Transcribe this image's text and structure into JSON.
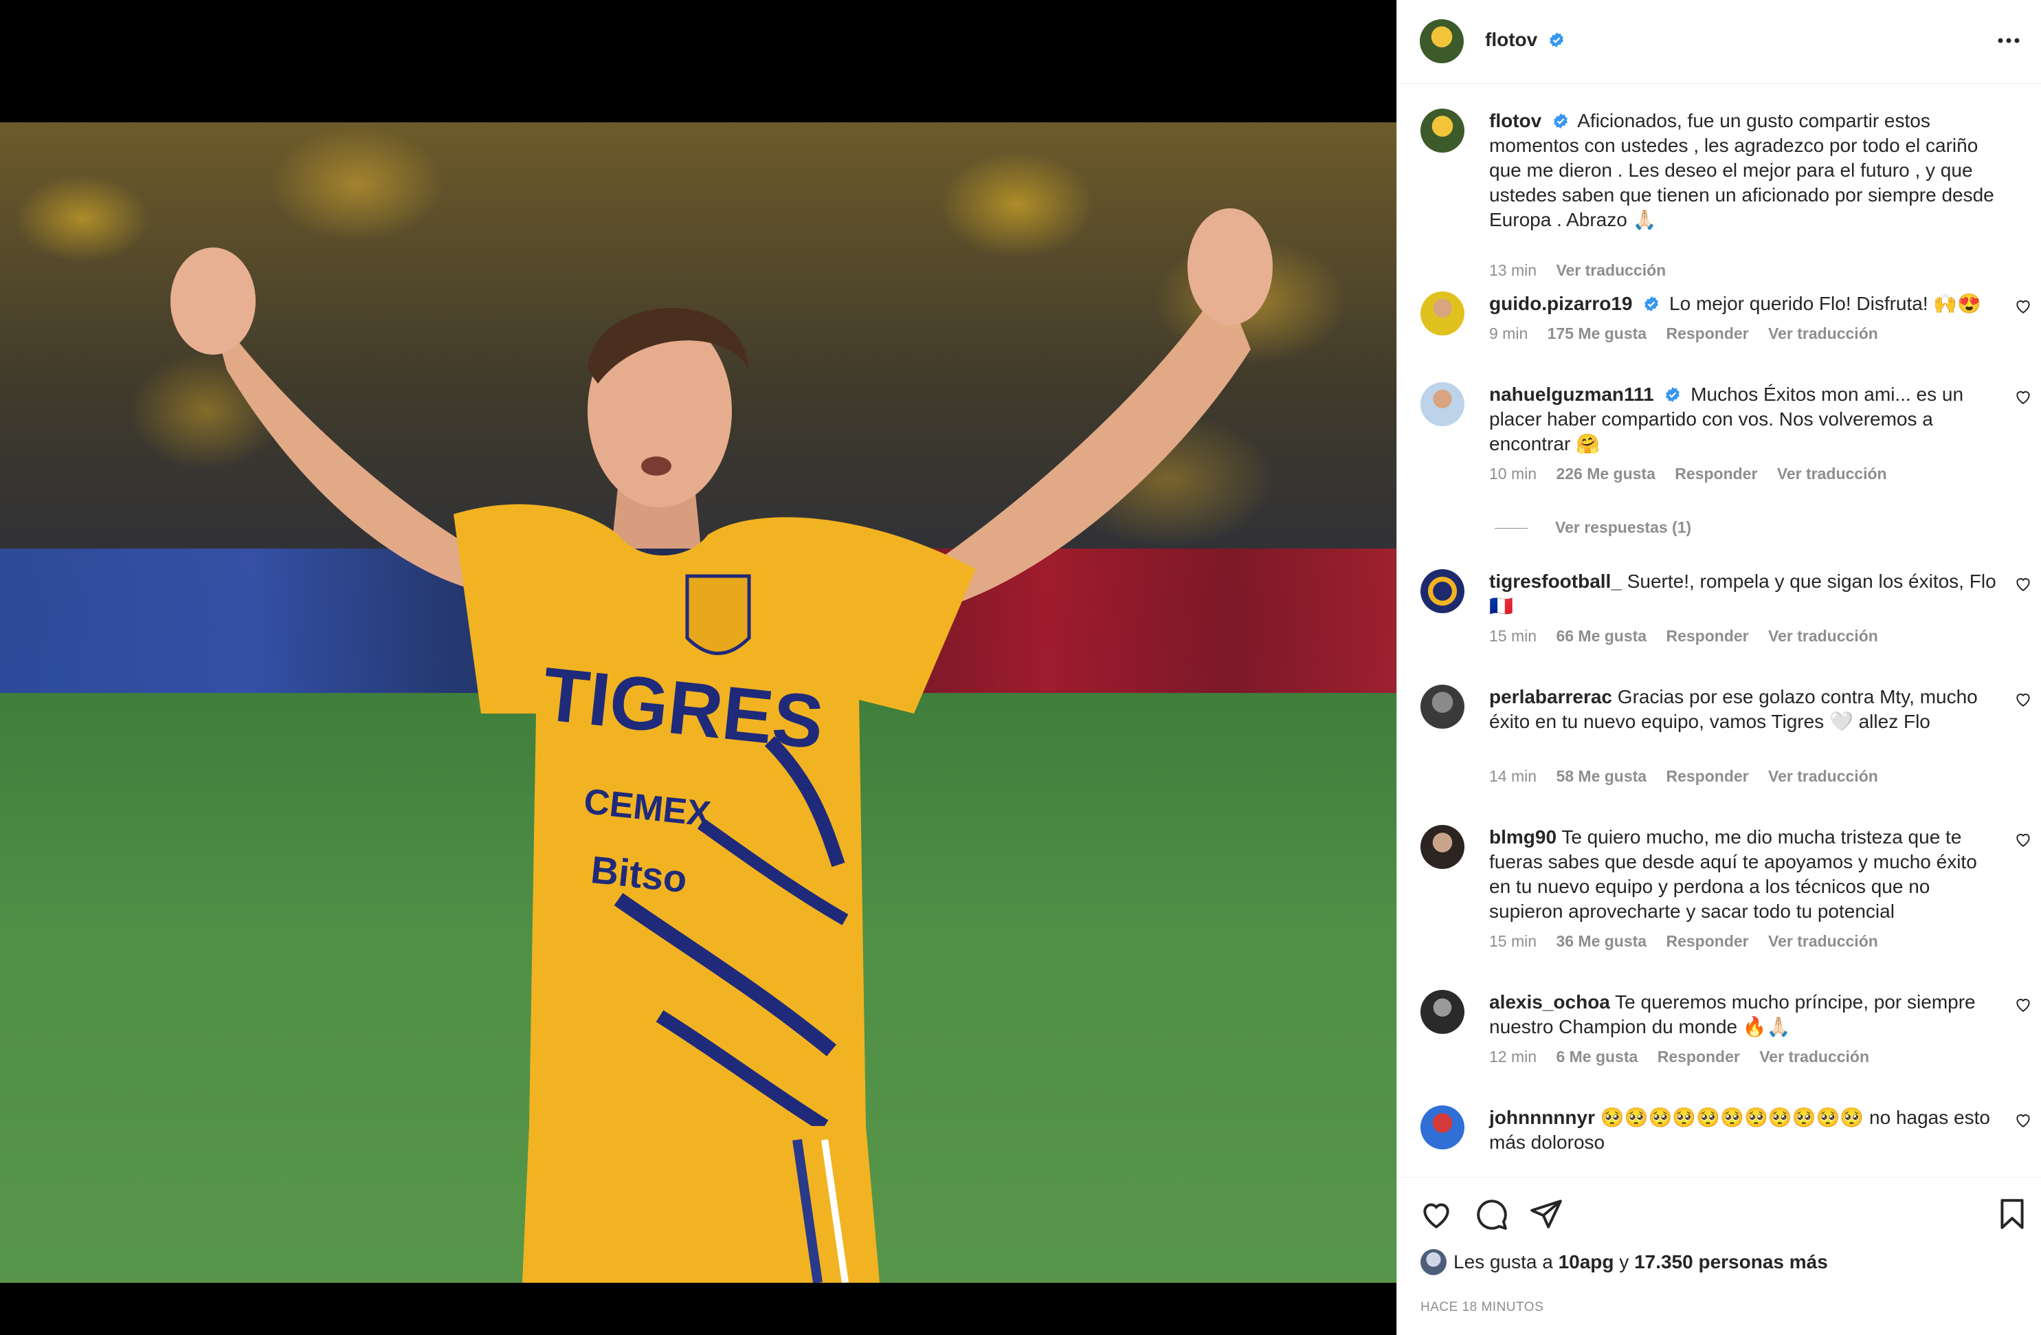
{
  "post": {
    "username": "flotov",
    "verified": true,
    "caption": "Aficionados, fue un gusto compartir estos momentos con ustedes , les agradezco por todo el cariño que me dieron . Les deseo el mejor para el futuro , y que ustedes saben que tienen un aficionado por siempre desde Europa . Abrazo 🙏🏻",
    "caption_time": "13 min",
    "caption_translate": "Ver traducción",
    "more_icon": "more-horizontal-icon"
  },
  "photo": {
    "jersey_text": "TIGRES",
    "sponsor_1": "CEMEX",
    "sponsor_2": "Bitso"
  },
  "comments": [
    {
      "username": "guido.pizarro19",
      "verified": true,
      "text": "Lo mejor querido Flo! Disfruta! 🙌😍",
      "time": "9 min",
      "likes": "175 Me gusta",
      "reply": "Responder",
      "translate": "Ver traducción"
    },
    {
      "username": "nahuelguzman111",
      "verified": true,
      "text": "Muchos Éxitos mon ami... es un placer haber compartido con vos. Nos volveremos a encontrar 🤗",
      "time": "10 min",
      "likes": "226 Me gusta",
      "reply": "Responder",
      "translate": "Ver traducción",
      "view_replies": "Ver respuestas (1)"
    },
    {
      "username": "tigresfootball_",
      "verified": false,
      "text": "Suerte!, rompela y que sigan los éxitos, Flo 🇫🇷",
      "time": "15 min",
      "likes": "66 Me gusta",
      "reply": "Responder",
      "translate": "Ver traducción"
    },
    {
      "username": "perlabarrerac",
      "verified": false,
      "text": "Gracias por ese golazo contra Mty, mucho éxito en tu nuevo equipo, vamos Tigres 🤍 allez Flo",
      "time": "14 min",
      "likes": "58 Me gusta",
      "reply": "Responder",
      "translate": "Ver traducción"
    },
    {
      "username": "blmg90",
      "verified": false,
      "text": "Te quiero mucho, me dio mucha tristeza que te fueras sabes que desde aquí te apoyamos y mucho éxito en tu nuevo equipo y perdona a los técnicos que no supieron aprovecharte y sacar todo tu potencial",
      "time": "15 min",
      "likes": "36 Me gusta",
      "reply": "Responder",
      "translate": "Ver traducción"
    },
    {
      "username": "alexis_ochoa",
      "verified": false,
      "text": "Te queremos mucho príncipe, por siempre nuestro Champion du monde 🔥🙏🏻",
      "time": "12 min",
      "likes": "6 Me gusta",
      "reply": "Responder",
      "translate": "Ver traducción"
    },
    {
      "username": "johnnnnnyr",
      "verified": false,
      "text": "🥺🥺🥺🥺🥺🥺🥺🥺🥺🥺🥺 no hagas esto más doloroso"
    }
  ],
  "footer": {
    "likes_prefix": "Les gusta a",
    "liker": "10apg",
    "likes_join": "y",
    "likes_rest": "17.350 personas más",
    "posted": "HACE 18 MINUTOS"
  },
  "colors": {
    "verified": "#3897f0",
    "text": "#262626",
    "muted": "#8e8e8e",
    "jersey": "#f2b322",
    "jersey_stripes": "#1f2a7a"
  }
}
